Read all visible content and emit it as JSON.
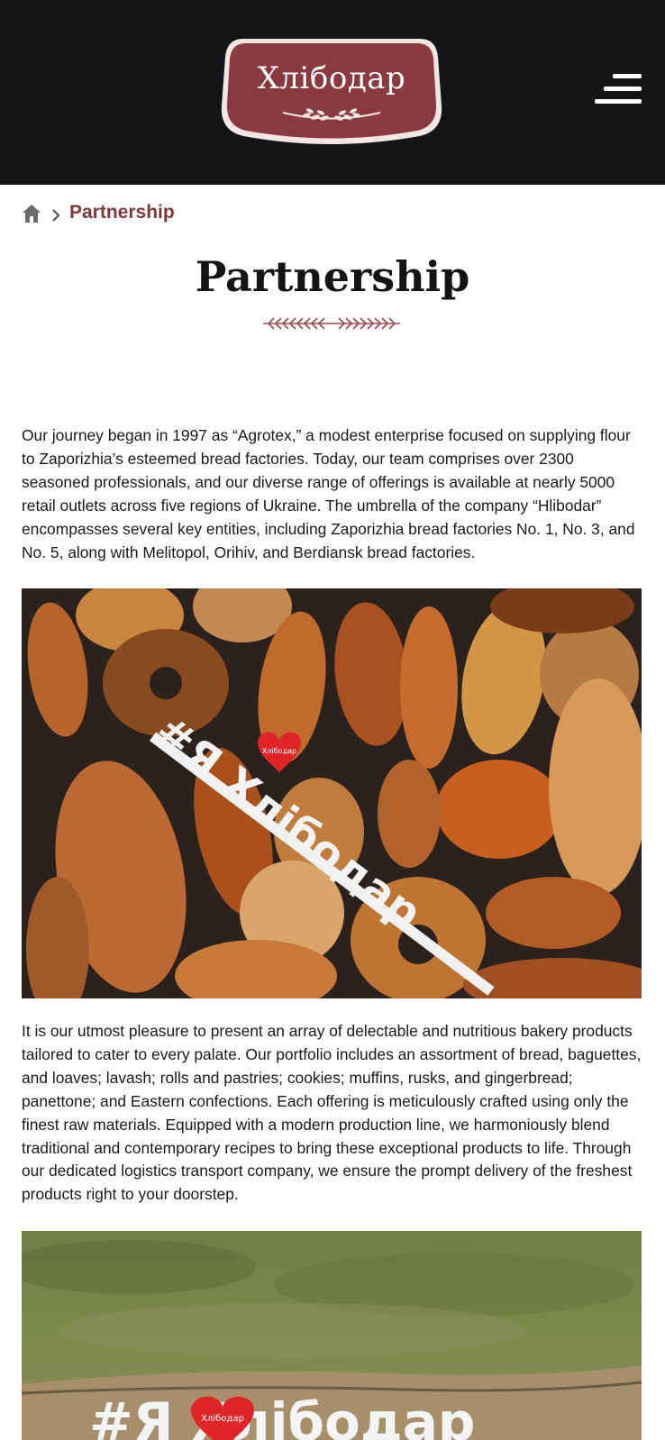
{
  "header": {
    "logo_text": "Хлібодар",
    "menu_icon": "hamburger-menu-icon",
    "background": "#141517"
  },
  "breadcrumb": {
    "home_icon": "home-icon",
    "separator_icon": "chevron-right-icon",
    "current": "Partnership"
  },
  "page": {
    "title": "Partnership",
    "accent_color": "#7d3a3c"
  },
  "content": {
    "paragraph_1": "Our journey began in 1997 as “Agrotex,” a modest enterprise focused on supplying flour to Zaporizhia’s esteemed bread factories. Today, our team comprises over 2300 seasoned professionals, and our diverse range of offerings is available at nearly 5000 retail outlets across five regions of Ukraine. The umbrella of the company “Hlibodar” encompasses several key entities, including Zaporizhia bread factories No. 1, No. 3, and No. 5, along with Melitopol, Orihiv, and Berdiansk bread factories.",
    "image_1_sign": "#Я Хлібодар",
    "image_1_heart_logo": "Хлібодар",
    "paragraph_2": "It is our utmost pleasure to present an array of delectable and nutritious bakery products tailored to cater to every palate. Our portfolio includes an assortment of bread, baguettes, and loaves; lavash; rolls and pastries; cookies; muffins, rusks, and gingerbread; panettone; and Eastern confections. Each offering is meticulously crafted using only the finest raw materials. Equipped with a modern production line, we harmoniously blend traditional and contemporary recipes to bring these exceptional products to life. Through our dedicated logistics transport company, we ensure the prompt delivery of the freshest products right to your doorstep.",
    "image_2_sign": "#Я Хлібодар",
    "image_2_heart_logo": "Хлібодар"
  }
}
